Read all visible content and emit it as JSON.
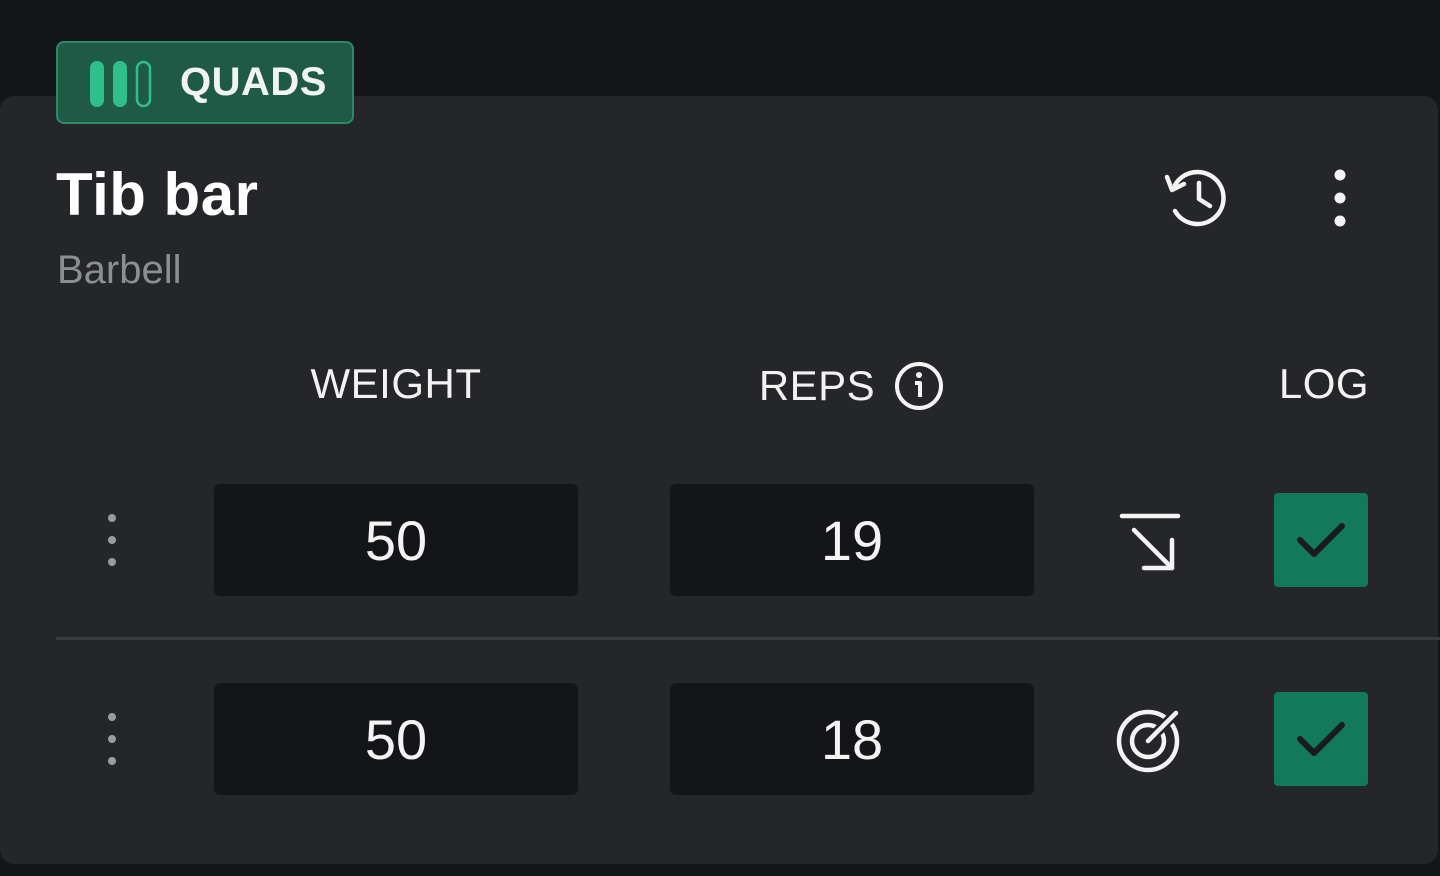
{
  "badge": {
    "label": "QUADS",
    "icon": "muscle-group-bars-icon"
  },
  "exercise": {
    "title": "Tib bar",
    "equipment": "Barbell"
  },
  "actions": {
    "history_icon": "history-icon",
    "more_icon": "more-vertical-icon"
  },
  "columns": {
    "weight": "WEIGHT",
    "reps": "REPS",
    "log": "LOG"
  },
  "sets": [
    {
      "weight": "50",
      "reps": "19",
      "status_icon": "drop-arrow-icon",
      "logged": true
    },
    {
      "weight": "50",
      "reps": "18",
      "status_icon": "target-icon",
      "logged": true
    }
  ],
  "colors": {
    "background": "#141518",
    "card": "#252629",
    "accent_green": "#127a5a",
    "badge_green": "#1f5a47",
    "badge_bar": "#2fbf8a",
    "muted_text": "#8d8e91"
  }
}
